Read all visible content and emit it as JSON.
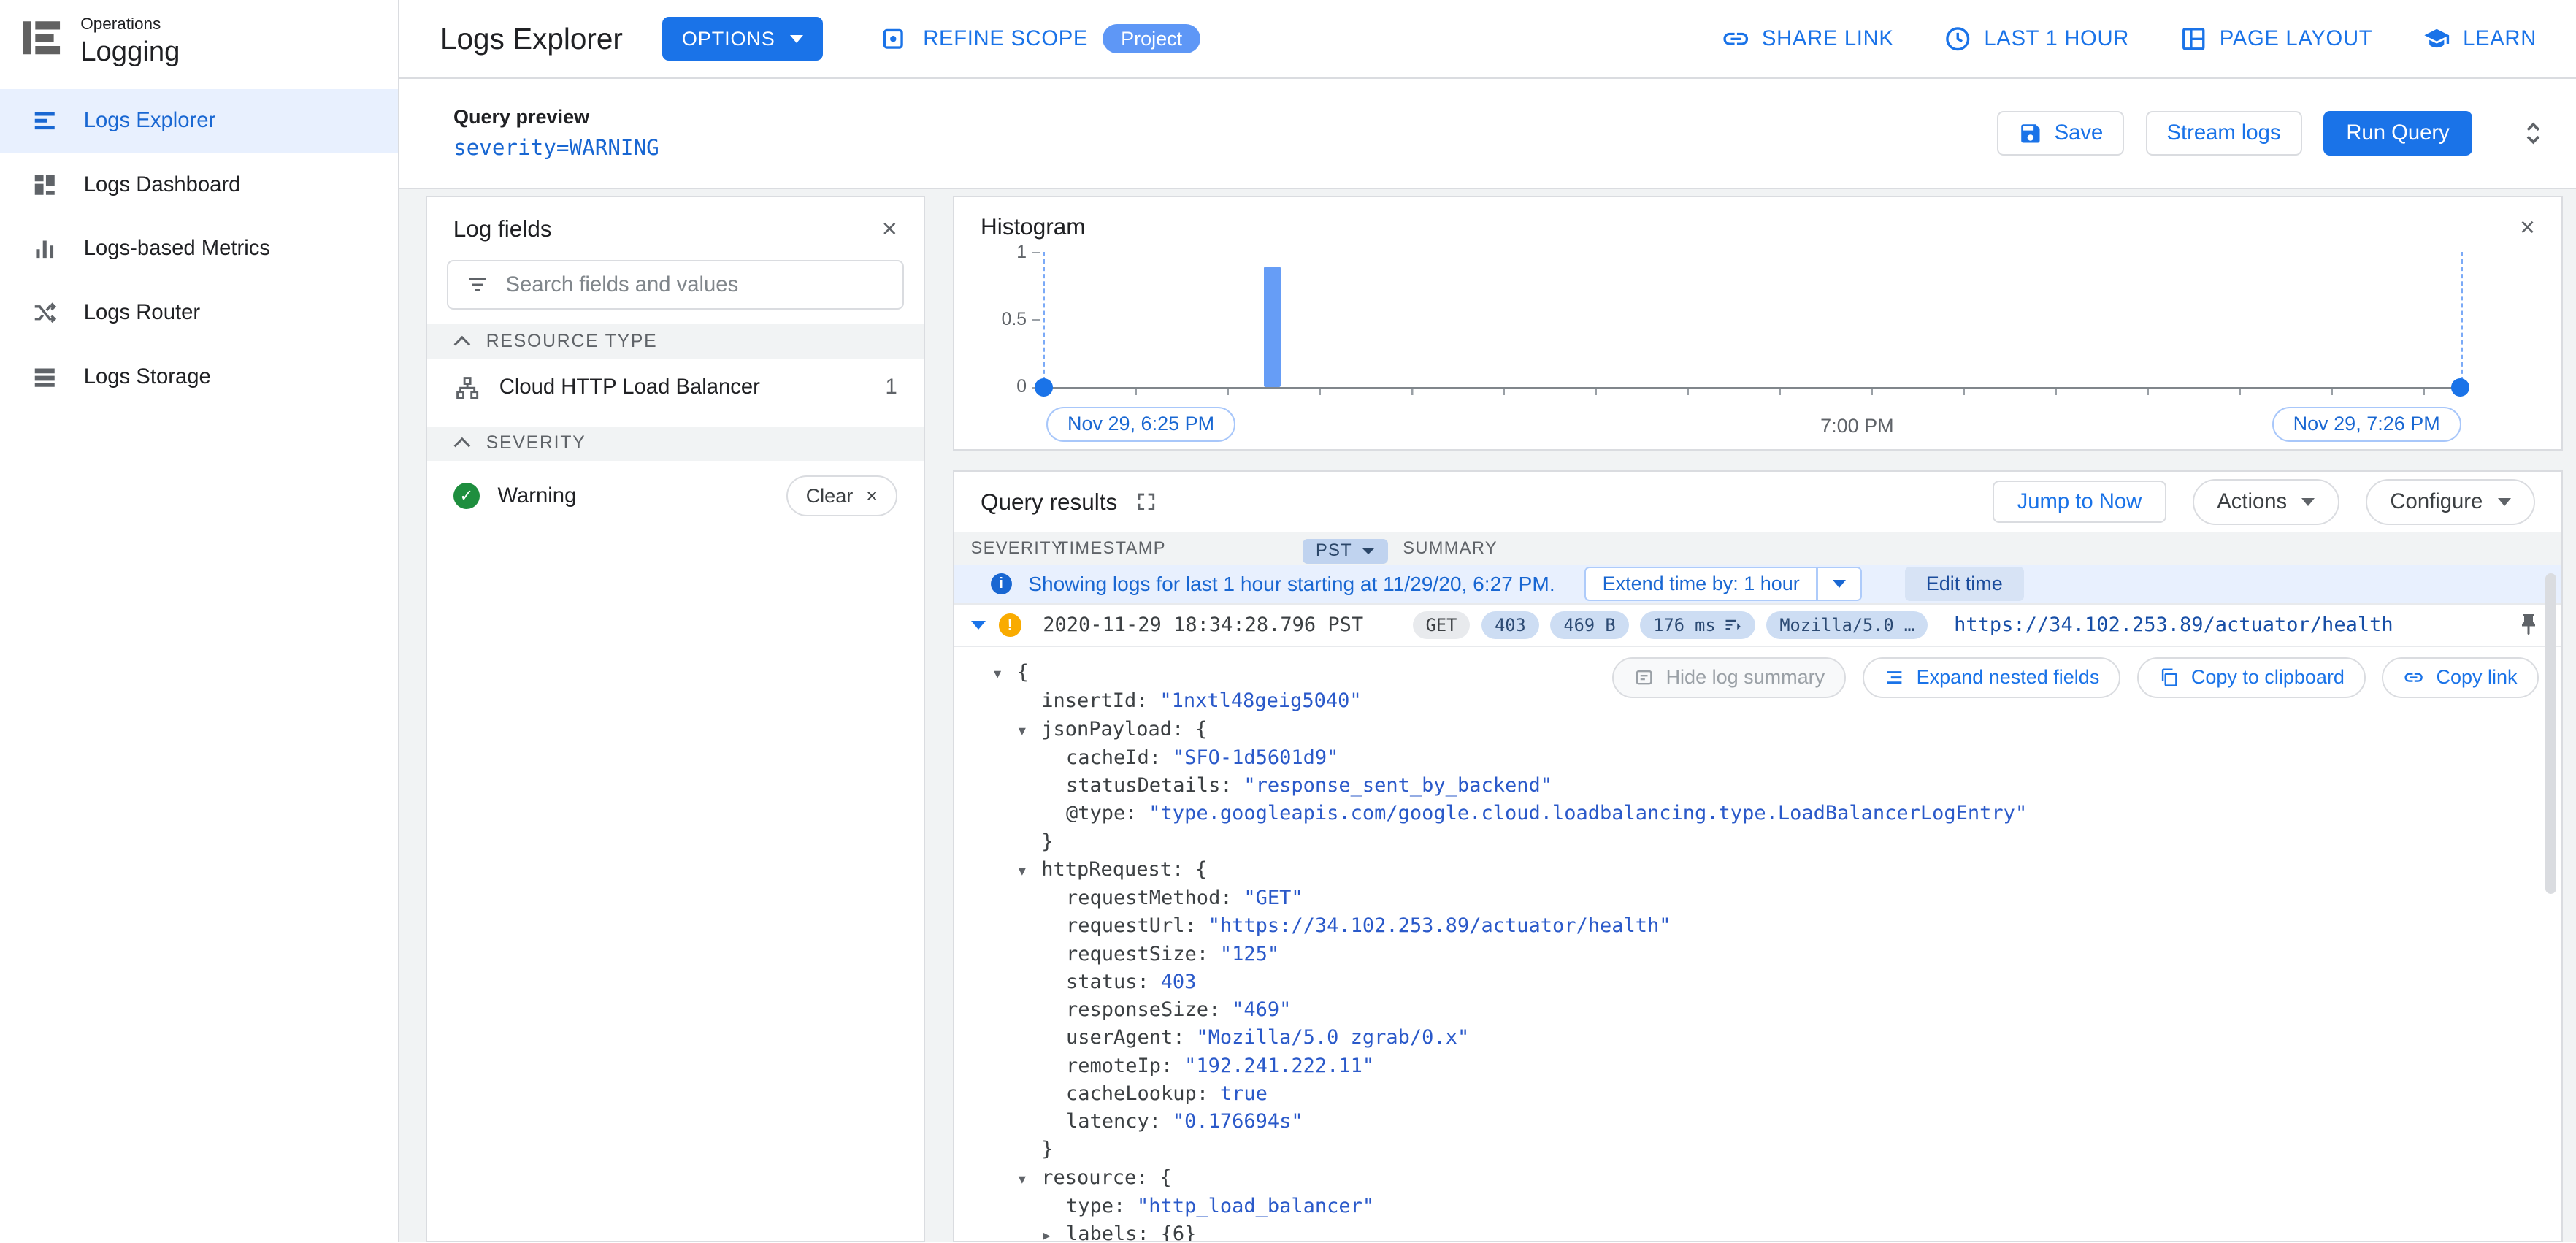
{
  "brand": {
    "product": "Operations",
    "name": "Logging"
  },
  "topbar": {
    "title": "Logs Explorer",
    "options_button": "OPTIONS",
    "refine_scope": "REFINE SCOPE",
    "refine_scope_badge": "Project",
    "share_link": "SHARE LINK",
    "last_hour": "LAST 1 HOUR",
    "page_layout": "PAGE LAYOUT",
    "learn": "LEARN"
  },
  "sidebar": {
    "items": [
      {
        "label": "Logs Explorer",
        "active": true
      },
      {
        "label": "Logs Dashboard",
        "active": false
      },
      {
        "label": "Logs-based Metrics",
        "active": false
      },
      {
        "label": "Logs Router",
        "active": false
      },
      {
        "label": "Logs Storage",
        "active": false
      }
    ]
  },
  "query_preview": {
    "label": "Query preview",
    "query": "severity=WARNING",
    "save": "Save",
    "stream_logs": "Stream logs",
    "run_query": "Run Query"
  },
  "log_fields": {
    "title": "Log fields",
    "search_placeholder": "Search fields and values",
    "resource_section": "RESOURCE TYPE",
    "resource_name": "Cloud HTTP Load Balancer",
    "resource_count": "1",
    "severity_section": "SEVERITY",
    "severity_name": "Warning",
    "clear_button": "Clear"
  },
  "histogram": {
    "title": "Histogram",
    "y_ticks": [
      "1",
      "0.5",
      "0"
    ],
    "range_start": "Nov 29, 6:25 PM",
    "range_mid": "7:00 PM",
    "range_end": "Nov 29, 7:26 PM",
    "bars": [
      {
        "time_fraction": 0.156,
        "count": 1
      }
    ]
  },
  "results": {
    "title": "Query results",
    "jump_to_now": "Jump to Now",
    "actions": "Actions",
    "configure": "Configure",
    "col_severity": "SEVERITY",
    "col_timestamp": "TIMESTAMP",
    "col_timezone": "PST",
    "col_summary": "SUMMARY",
    "info_text": "Showing logs for last 1 hour starting at 11/29/20, 6:27 PM.",
    "extend_time": "Extend time by: 1 hour",
    "edit_time": "Edit time",
    "entry": {
      "timestamp": "2020-11-29 18:34:28.796 PST",
      "chips": [
        {
          "label": "GET",
          "style": "gray"
        },
        {
          "label": "403",
          "style": "blue"
        },
        {
          "label": "469 B",
          "style": "blue"
        },
        {
          "label": "176 ms",
          "style": "blue",
          "icon": true
        },
        {
          "label": "Mozilla/5.0 …",
          "style": "blue"
        }
      ],
      "url": "https://34.102.253.89/actuator/health"
    },
    "buttons": {
      "hide_summary": "Hide log summary",
      "expand_nested": "Expand nested fields",
      "copy_clipboard": "Copy to clipboard",
      "copy_link": "Copy link"
    },
    "json_lines": [
      {
        "ind": 0,
        "tg": "▾",
        "b": "{"
      },
      {
        "ind": 1,
        "tg": "",
        "k": "insertId",
        "v": "\"1nxtl48geig5040\""
      },
      {
        "ind": 1,
        "tg": "▾",
        "k": "jsonPayload",
        "b": "{"
      },
      {
        "ind": 2,
        "tg": "",
        "k": "cacheId",
        "v": "\"SFO-1d5601d9\""
      },
      {
        "ind": 2,
        "tg": "",
        "k": "statusDetails",
        "v": "\"response_sent_by_backend\""
      },
      {
        "ind": 2,
        "tg": "",
        "k": "@type",
        "v": "\"type.googleapis.com/google.cloud.loadbalancing.type.LoadBalancerLogEntry\""
      },
      {
        "ind": 1,
        "tg": "",
        "b": "}"
      },
      {
        "ind": 1,
        "tg": "▾",
        "k": "httpRequest",
        "b": "{"
      },
      {
        "ind": 2,
        "tg": "",
        "k": "requestMethod",
        "v": "\"GET\""
      },
      {
        "ind": 2,
        "tg": "",
        "k": "requestUrl",
        "v": "\"https://34.102.253.89/actuator/health\""
      },
      {
        "ind": 2,
        "tg": "",
        "k": "requestSize",
        "v": "\"125\""
      },
      {
        "ind": 2,
        "tg": "",
        "k": "status",
        "v": "403"
      },
      {
        "ind": 2,
        "tg": "",
        "k": "responseSize",
        "v": "\"469\""
      },
      {
        "ind": 2,
        "tg": "",
        "k": "userAgent",
        "v": "\"Mozilla/5.0 zgrab/0.x\""
      },
      {
        "ind": 2,
        "tg": "",
        "k": "remoteIp",
        "v": "\"192.241.222.11\""
      },
      {
        "ind": 2,
        "tg": "",
        "k": "cacheLookup",
        "v": "true"
      },
      {
        "ind": 2,
        "tg": "",
        "k": "latency",
        "v": "\"0.176694s\""
      },
      {
        "ind": 1,
        "tg": "",
        "b": "}"
      },
      {
        "ind": 1,
        "tg": "▾",
        "k": "resource",
        "b": "{"
      },
      {
        "ind": 2,
        "tg": "",
        "k": "type",
        "v": "\"http_load_balancer\""
      },
      {
        "ind": 2,
        "tg": "▸",
        "k": "labels",
        "b": "{6}"
      }
    ]
  }
}
